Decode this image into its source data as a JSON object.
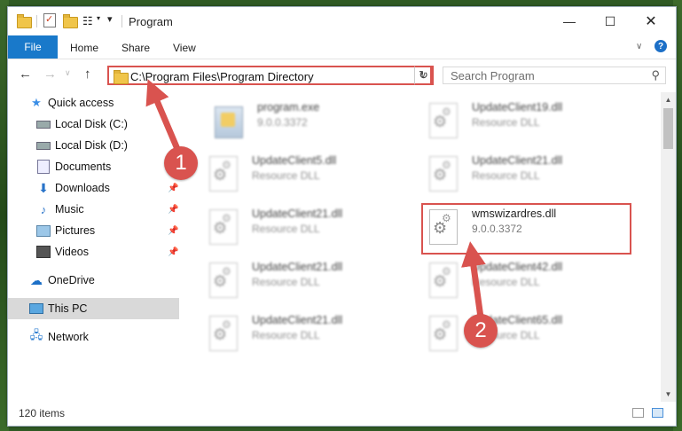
{
  "window": {
    "title": "Program"
  },
  "ribbon": {
    "tabs": [
      "File",
      "Home",
      "Share",
      "View"
    ]
  },
  "navbar": {
    "path": "C:\\Program Files\\Program Directory",
    "search_placeholder": "Search Program"
  },
  "sidebar": {
    "items": [
      {
        "label": "Quick access",
        "icon": "star-icon"
      },
      {
        "label": "Local Disk (C:)",
        "icon": "drive-icon"
      },
      {
        "label": "Local Disk (D:)",
        "icon": "drive-icon"
      },
      {
        "label": "Documents",
        "icon": "documents-icon"
      },
      {
        "label": "Downloads",
        "icon": "downloads-icon"
      },
      {
        "label": "Music",
        "icon": "music-icon"
      },
      {
        "label": "Pictures",
        "icon": "pictures-icon"
      },
      {
        "label": "Videos",
        "icon": "videos-icon"
      },
      {
        "label": "OneDrive",
        "icon": "onedrive-icon"
      },
      {
        "label": "This PC",
        "icon": "this-pc-icon"
      },
      {
        "label": "Network",
        "icon": "network-icon"
      }
    ]
  },
  "files": [
    {
      "name": "program.exe",
      "desc": "9.0.0.3372"
    },
    {
      "name": "UpdateClient19.dll",
      "desc": "Resource DLL"
    },
    {
      "name": "UpdateClient5.dll",
      "desc": "Resource DLL"
    },
    {
      "name": "UpdateClient21.dll",
      "desc": "Resource DLL"
    },
    {
      "name": "UpdateClient21.dll",
      "desc": "Resource DLL"
    },
    {
      "name": "wmswizardres.dll",
      "desc": "9.0.0.3372"
    },
    {
      "name": "UpdateClient21.dll",
      "desc": "Resource DLL"
    },
    {
      "name": "UpdateClient42.dll",
      "desc": "Resource DLL"
    },
    {
      "name": "UpdateClient21.dll",
      "desc": "Resource DLL"
    },
    {
      "name": "UpdateClient65.dll",
      "desc": "Resource DLL"
    }
  ],
  "status": {
    "count": "120 items"
  },
  "callouts": [
    "1",
    "2"
  ],
  "colors": {
    "accent": "#1979ca",
    "highlight": "#d9534f"
  }
}
